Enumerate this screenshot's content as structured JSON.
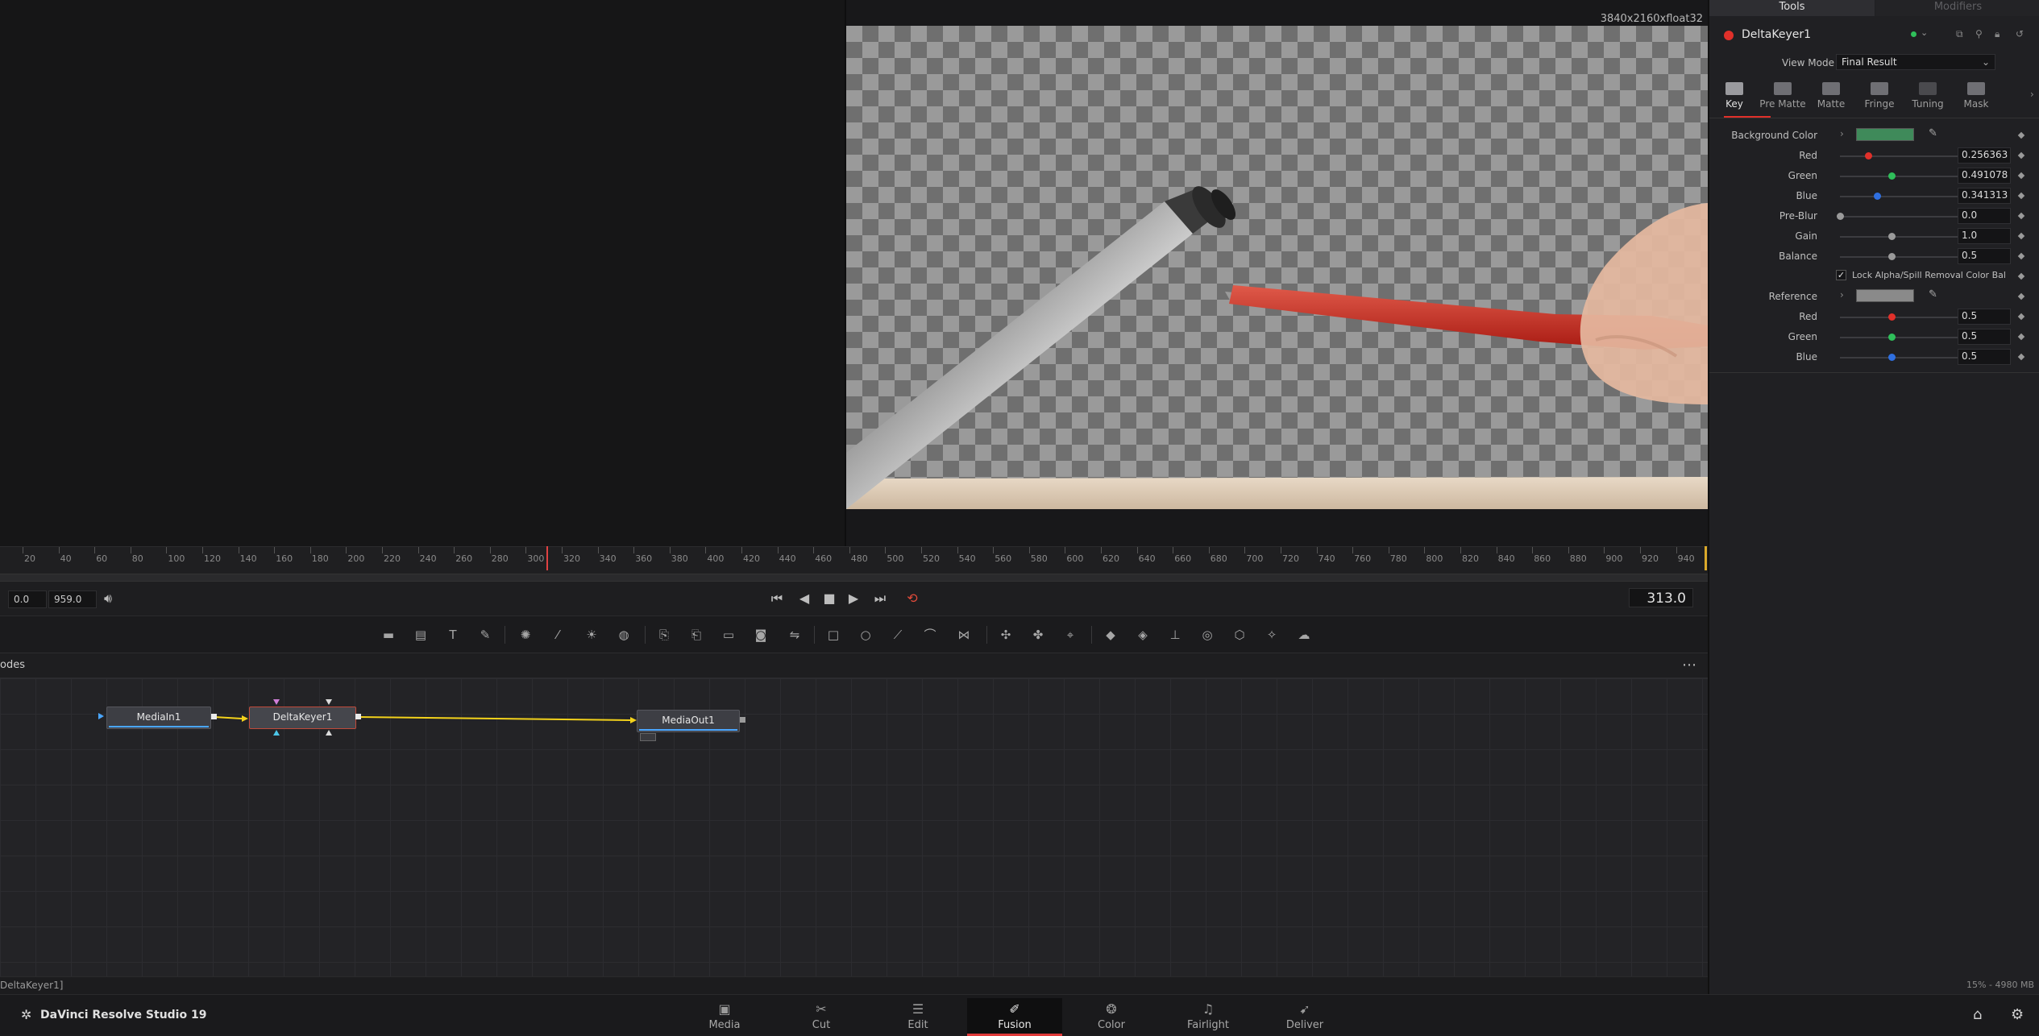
{
  "viewer": {
    "resolution_label": "3840x2160xfloat32"
  },
  "timeline": {
    "ticks": [
      "20",
      "40",
      "60",
      "80",
      "100",
      "120",
      "140",
      "160",
      "180",
      "200",
      "220",
      "240",
      "260",
      "280",
      "300",
      "320",
      "340",
      "360",
      "380",
      "400",
      "420",
      "440",
      "460",
      "480",
      "500",
      "520",
      "540",
      "560",
      "580",
      "600",
      "620",
      "640",
      "660",
      "680",
      "700",
      "720",
      "740",
      "760",
      "780",
      "800",
      "820",
      "840",
      "860",
      "880",
      "900",
      "920",
      "940"
    ],
    "start": "0.0",
    "end": "959.0",
    "current_frame": "313.0"
  },
  "nodes": {
    "panel_title": "odes",
    "items": [
      "MediaIn1",
      "DeltaKeyer1",
      "MediaOut1"
    ]
  },
  "status": {
    "left": "DeltaKeyer1]",
    "right": "15% - 4980 MB"
  },
  "inspector": {
    "tabs": [
      "Tools",
      "Modifiers"
    ],
    "node_name": "DeltaKeyer1",
    "view_mode_label": "View Mode",
    "view_mode_value": "Final Result",
    "key_tabs": [
      "Key",
      "Pre Matte",
      "Matte",
      "Fringe",
      "Tuning",
      "Mask"
    ],
    "params": {
      "bg_color_label": "Background Color",
      "red_label": "Red",
      "red_value": "0.256363",
      "green_label": "Green",
      "green_value": "0.491078",
      "blue_label": "Blue",
      "blue_value": "0.341313",
      "preblur_label": "Pre-Blur",
      "preblur_value": "0.0",
      "gain_label": "Gain",
      "gain_value": "1.0",
      "balance_label": "Balance",
      "balance_value": "0.5",
      "lock_label": "Lock Alpha/Spill Removal Color Bal",
      "reference_label": "Reference",
      "ref_red_label": "Red",
      "ref_red_value": "0.5",
      "ref_green_label": "Green",
      "ref_green_value": "0.5",
      "ref_blue_label": "Blue",
      "ref_blue_value": "0.5"
    },
    "colors": {
      "background_swatch": "#3f8a5a",
      "reference_swatch": "#8a8a8a"
    }
  },
  "pagebar": {
    "app_name": "DaVinci Resolve Studio 19",
    "pages": [
      "Media",
      "Cut",
      "Edit",
      "Fusion",
      "Color",
      "Fairlight",
      "Deliver"
    ],
    "active_page": "Fusion"
  }
}
